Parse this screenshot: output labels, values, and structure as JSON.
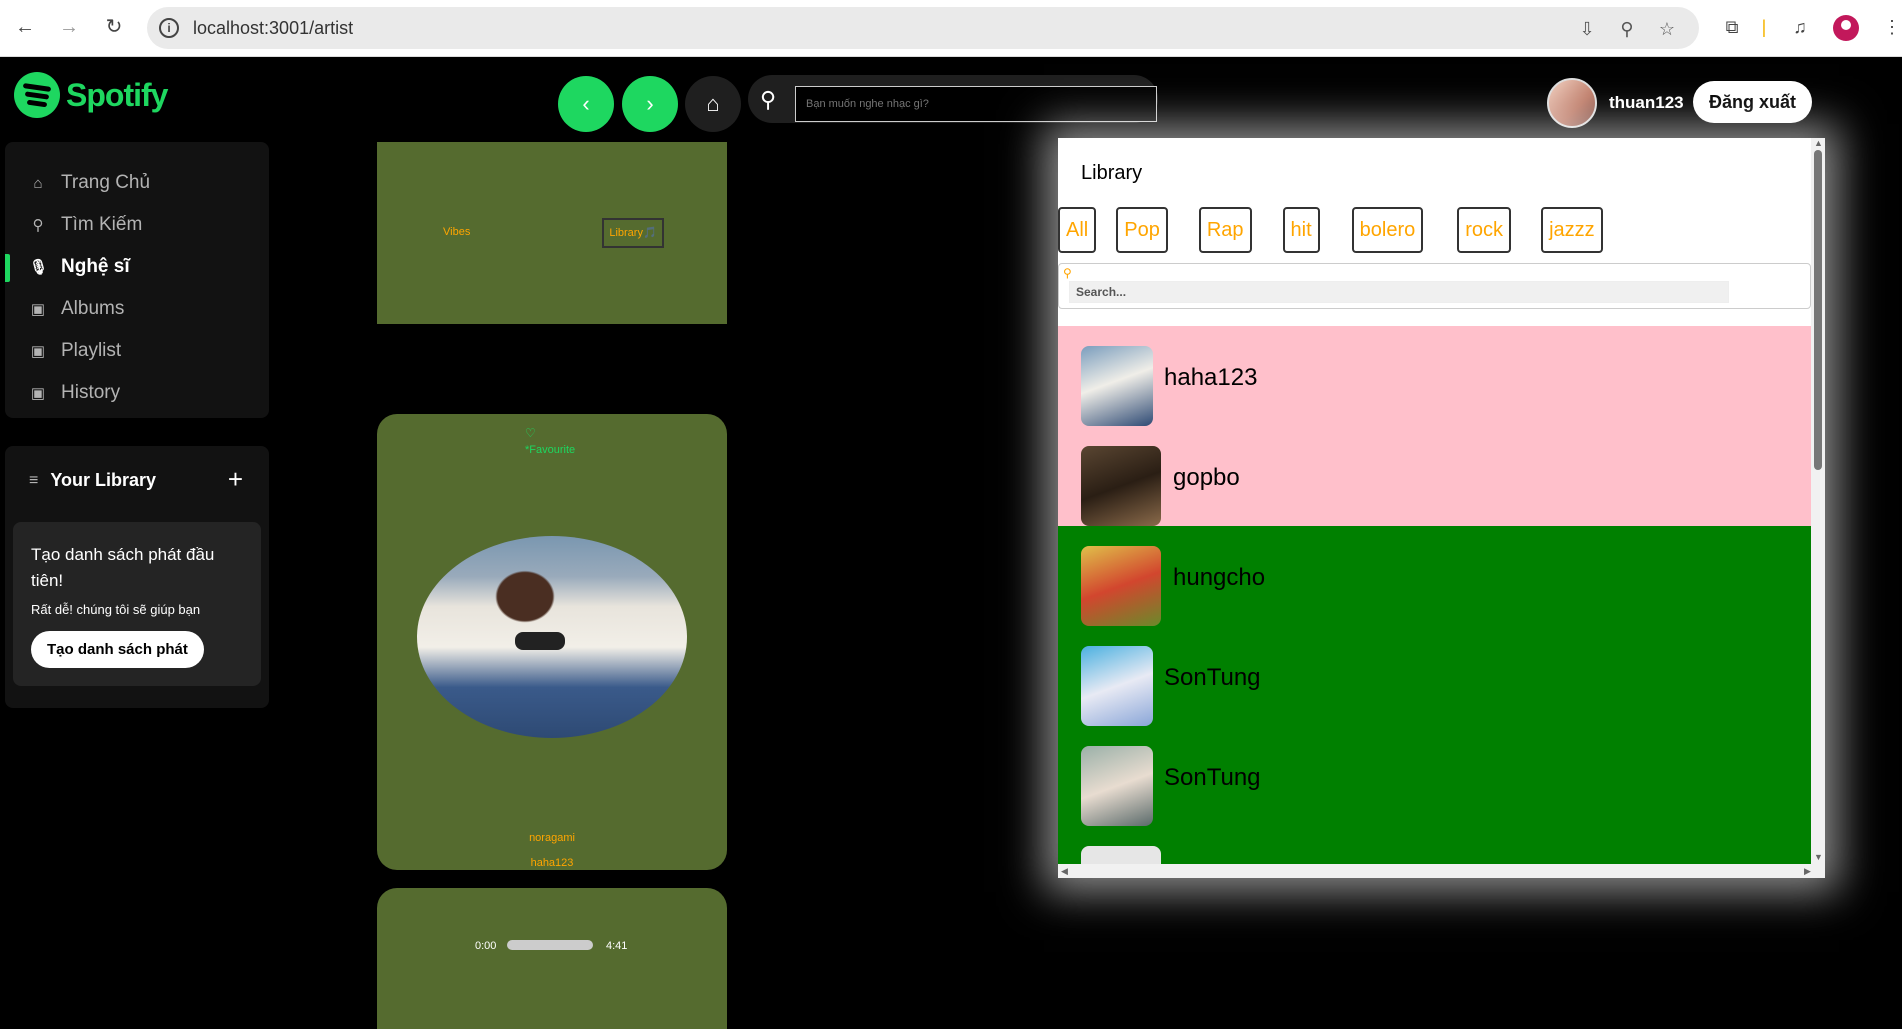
{
  "browser": {
    "url": "localhost:3001/artist"
  },
  "app": {
    "logo_text": "Spotify",
    "nav": [
      {
        "label": "Trang Chủ",
        "icon": "home-icon"
      },
      {
        "label": "Tìm Kiếm",
        "icon": "search-icon"
      },
      {
        "label": "Nghệ sĩ",
        "icon": "microphone-icon",
        "active": true
      },
      {
        "label": "Albums",
        "icon": "album-icon"
      },
      {
        "label": "Playlist",
        "icon": "playlist-icon"
      },
      {
        "label": "History",
        "icon": "history-icon"
      }
    ],
    "library": {
      "title": "Your Library",
      "card_title": "Tạo danh sách phát đầu tiên!",
      "card_subtitle": "Rất dễ! chúng tôi sẽ giúp bạn",
      "card_button": "Tạo danh sách phát"
    },
    "search_placeholder": "Bạn muốn nghe nhạc gì?",
    "username": "thuan123",
    "logout_label": "Đăng xuất",
    "accent_color": "#1ed760"
  },
  "content": {
    "card1": {
      "vibes": "Vibes",
      "library_button": "Library🎵"
    },
    "card2": {
      "favourite": "*Favourite",
      "song": "noragami",
      "artist": "haha123"
    },
    "player": {
      "current_time": "0:00",
      "duration": "4:41",
      "progress": 0
    }
  },
  "panel": {
    "title": "Library",
    "filters": [
      "All",
      "Pop",
      "Rap",
      "hit",
      "bolero",
      "rock",
      "jazzz"
    ],
    "search_placeholder": "Search...",
    "artists": [
      {
        "name": "haha123",
        "bg": "#ffc0cb"
      },
      {
        "name": "gopbo",
        "bg": "#ffc0cb"
      },
      {
        "name": "hungcho",
        "bg": "#008000"
      },
      {
        "name": "SonTung",
        "bg": "#008000"
      },
      {
        "name": "SonTung",
        "bg": "#008000"
      }
    ]
  }
}
